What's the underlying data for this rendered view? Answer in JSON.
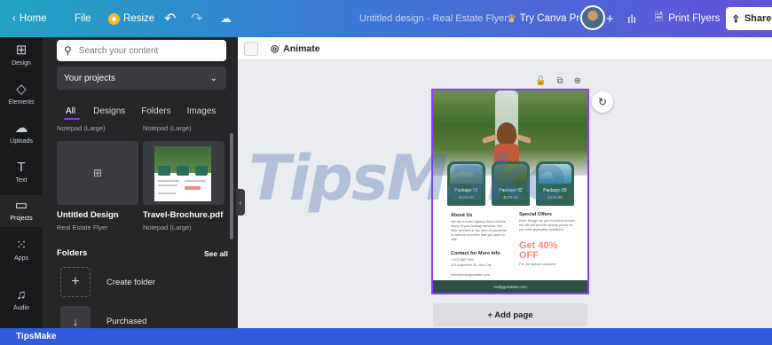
{
  "topbar": {
    "home": "Home",
    "file": "File",
    "resize": "Resize",
    "doc_title": "Untitled design - Real Estate Flyer",
    "try_pro": "Try Canva Pro",
    "print": "Print Flyers",
    "share": "Share"
  },
  "rail": [
    {
      "label": "Design",
      "icon": "layout-icon"
    },
    {
      "label": "Elements",
      "icon": "shapes-icon"
    },
    {
      "label": "Uploads",
      "icon": "cloud-upload-icon"
    },
    {
      "label": "Text",
      "icon": "text-icon"
    },
    {
      "label": "Projects",
      "icon": "folder-icon"
    },
    {
      "label": "Apps",
      "icon": "apps-grid-icon"
    },
    {
      "label": "Audio",
      "icon": "music-icon"
    }
  ],
  "panel": {
    "search_placeholder": "Search your content",
    "select_value": "Your projects",
    "tabs": [
      "All",
      "Designs",
      "Folders",
      "Images"
    ],
    "top_labels": [
      "Notepad (Large)",
      "Notepad (Large)"
    ],
    "files": [
      {
        "name": "Untitled Design",
        "sub": "Real Estate Flyer"
      },
      {
        "name": "Travel-Brochure.pdf",
        "sub": "Notepad (Large)"
      }
    ],
    "folders_heading": "Folders",
    "see_all": "See all",
    "folder_items": [
      "Create folder",
      "Purchased"
    ]
  },
  "canvas": {
    "animate": "Animate",
    "add_page": "+ Add page"
  },
  "design": {
    "packages": [
      {
        "title": "Package 01",
        "price": "$150.00"
      },
      {
        "title": "Package 02",
        "price": "$175.00"
      },
      {
        "title": "Package 03",
        "price": "$100.00"
      }
    ],
    "about_h": "About Us",
    "about_text": "We are a travel agency that provides many of your holiday services. We offer services in the form of vacations to various countries that you want to visit.",
    "special_h": "Special Offers",
    "special_text": "Even though we get excellent service, we will still provide special prices for you with applicable conditions",
    "contact_h": "Contact for More Info",
    "contact_lines": [
      "+123-4567-890",
      "123 Anywhere St., Any City",
      "hello@reallygreatsite.com"
    ],
    "offer": "Get 40% OFF",
    "offer_sub": "For our special customer",
    "footer": "reallygreatsite.com"
  },
  "watermark": "TipsMake",
  "bottom_brand": "TipsMake"
}
